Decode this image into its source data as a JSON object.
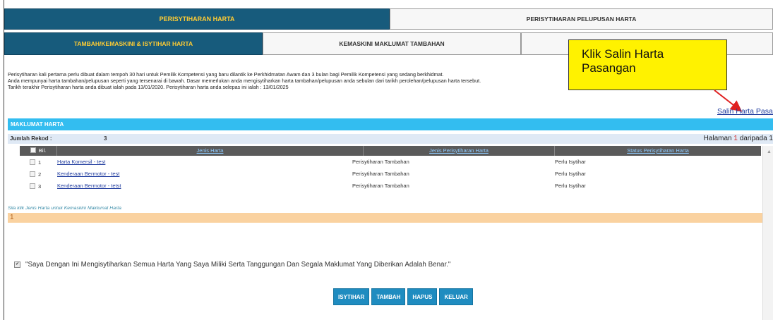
{
  "tabs_main": [
    {
      "label": "PERISYTIHARAN HARTA",
      "active": true
    },
    {
      "label": "PERISYTIHARAN PELUPUSAN HARTA",
      "active": false
    }
  ],
  "tabs_sub": [
    {
      "label": "TAMBAH/KEMASKINI & ISYTIHAR HARTA",
      "active": true
    },
    {
      "label": "KEMASKINI MAKLUMAT TAMBAHAN",
      "active": false
    },
    {
      "label": "",
      "active": false
    }
  ],
  "callout": {
    "line1": "Klik Salin Harta",
    "line2": "Pasangan"
  },
  "info": {
    "line1": "Perisytiharan kali pertama perlu dibuat dalam tempoh 30 hari untuk Pemilik Kompetensi yang baru dilantik ke Perkhidmatan Awam dan 3 bulan bagi Pemilik Kompetensi yang sedang berkhidmat.",
    "line2": "Anda mempunyai harta tambahan/pelupusan seperti yang tersenarai di bawah. Dasar memerlukan anda mengisytiharkan harta tambahan/pelupusan anda sebulan dari tarikh perolehan/pelupusan harta tersebut.",
    "line3": "Tarikh terakhir Perisytiharan harta anda dibuat ialah pada 13/01/2020. Perisytiharan harta anda selepas ini ialah : 13/01/2025"
  },
  "salin_link": "Salin Harta Pasangan",
  "section_title": "MAKLUMAT HARTA",
  "rekod": {
    "label": "Jumlah Rekod :",
    "count": "3"
  },
  "pagination": {
    "prefix": "Halaman",
    "page": "1",
    "suffix": "daripada 1"
  },
  "table": {
    "headers": {
      "bil": "Bil.",
      "jenis_harta": "Jenis Harta",
      "jenis_perisytiharan": "Jenis Perisytiharan Harta",
      "status": "Status Perisytiharan Harta"
    },
    "rows": [
      {
        "bil": "1",
        "jenis_harta": "Harta Komersil - test",
        "jenis_perisytiharan": "Perisytiharan Tambahan",
        "status": "Perlu Isytihar"
      },
      {
        "bil": "2",
        "jenis_harta": "Kenderaan Bermotor - test",
        "jenis_perisytiharan": "Perisytiharan Tambahan",
        "status": "Perlu Isytihar"
      },
      {
        "bil": "3",
        "jenis_harta": "Kenderaan Bermotor - tetst",
        "jenis_perisytiharan": "Perisytiharan Tambahan",
        "status": "Perlu Isytihar"
      }
    ]
  },
  "hint": "Sila klik Jenis Harta untuk Kemaskini Maklumat Harta",
  "page_indicator": "1",
  "declaration": "\"Saya Dengan Ini Mengisytiharkan Semua Harta Yang Saya Miliki Serta Tanggungan Dan Segala Maklumat Yang Diberikan Adalah Benar.\"",
  "buttons": {
    "isytihar": "ISYTIHAR",
    "tambah": "TAMBAH",
    "hapus": "HAPUS",
    "keluar": "KELUAR"
  },
  "colors": {
    "primary_tab": "#175b7c",
    "tab_text": "#ffcc33",
    "section": "#33bdf0",
    "button": "#1f8cc0",
    "callout": "#fff200",
    "arrow": "#e02020"
  }
}
